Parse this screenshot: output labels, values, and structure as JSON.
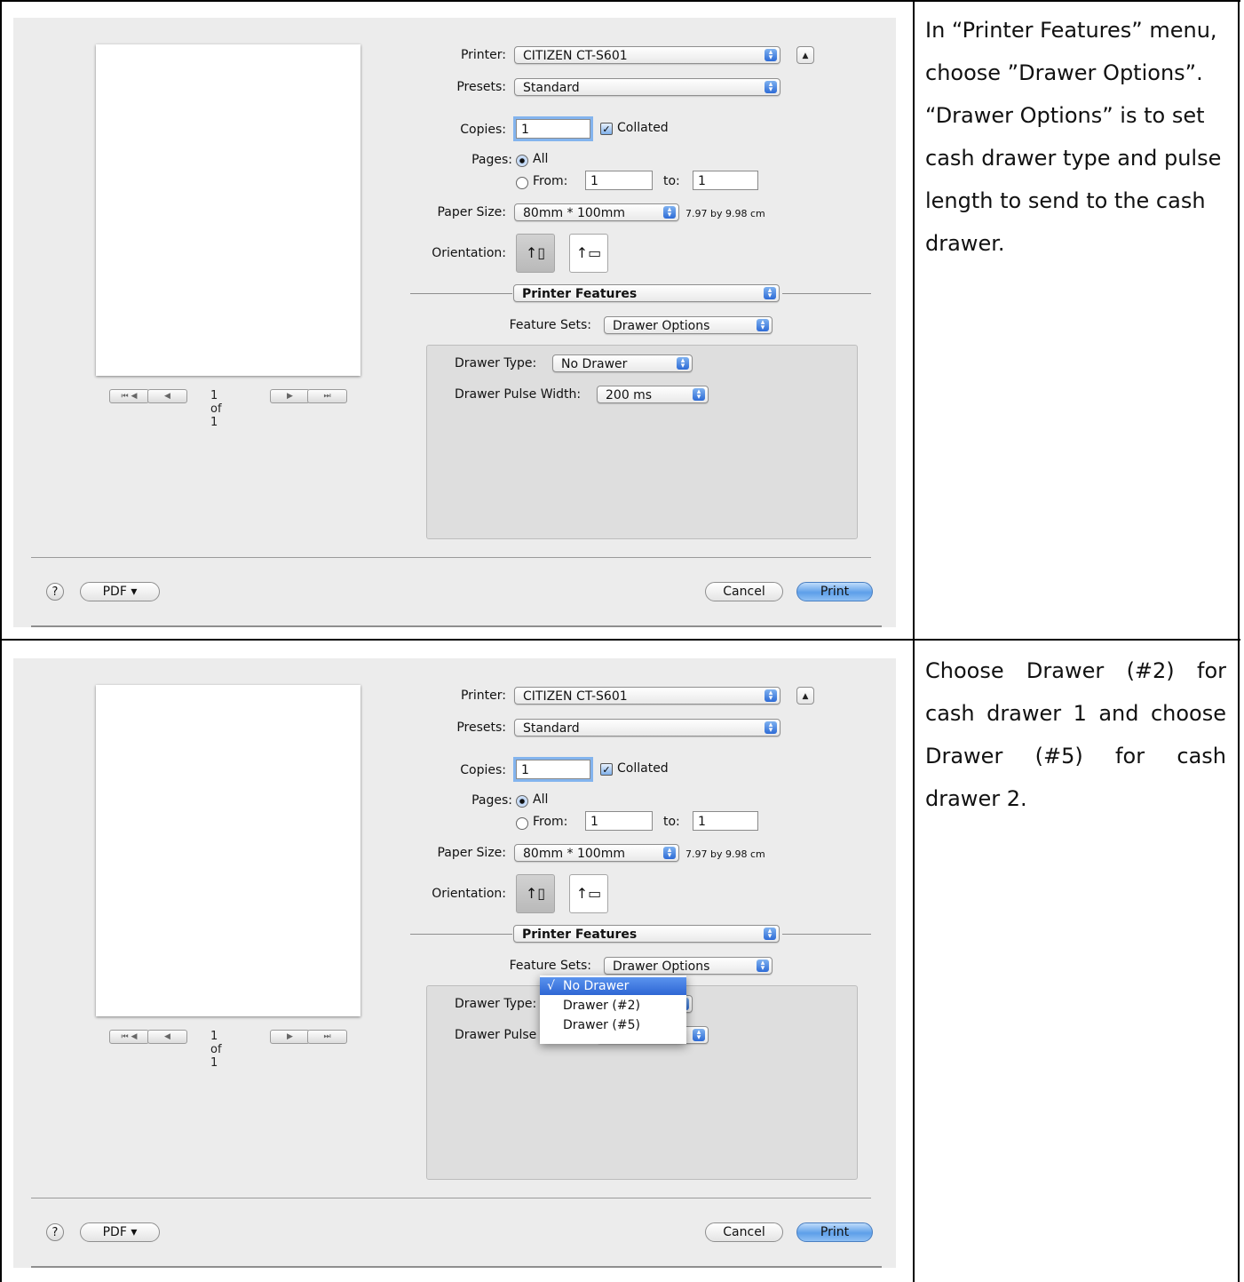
{
  "dialog": {
    "printer_label": "Printer:",
    "printer_value": "CITIZEN CT-S601",
    "presets_label": "Presets:",
    "presets_value": "Standard",
    "copies_label": "Copies:",
    "copies_value": "1",
    "collated_label": "Collated",
    "pages_label": "Pages:",
    "pages_all": "All",
    "pages_from": "From:",
    "pages_from_value": "1",
    "pages_to": "to:",
    "pages_to_value": "1",
    "paper_size_label": "Paper Size:",
    "paper_size_value": "80mm * 100mm",
    "paper_size_dims": "7.97 by 9.98 cm",
    "orientation_label": "Orientation:",
    "section_value": "Printer Features",
    "feature_sets_label": "Feature Sets:",
    "feature_sets_value": "Drawer Options",
    "drawer_type_label": "Drawer Type:",
    "drawer_type_value": "No Drawer",
    "drawer_pulse_label": "Drawer Pulse Width:",
    "drawer_pulse_value": "200 ms",
    "drawer_pulse_label_partial": "Drawer Pulse",
    "page_indicator": "1 of 1",
    "help": "?",
    "pdf_label": "PDF ▾",
    "cancel_label": "Cancel",
    "print_label": "Print"
  },
  "drawer_type_menu": {
    "items": [
      "No Drawer",
      "Drawer (#2)",
      "Drawer (#5)"
    ],
    "selected": "No Drawer",
    "check": "√"
  },
  "instructions": {
    "step1": "In “Printer Features” menu, choose ”Drawer Options”. “Drawer Options” is to set cash drawer type and pulse length to send to the cash drawer.",
    "step2": "Choose Drawer (#2) for cash drawer 1 and choose Drawer (#5) for cash drawer 2."
  }
}
